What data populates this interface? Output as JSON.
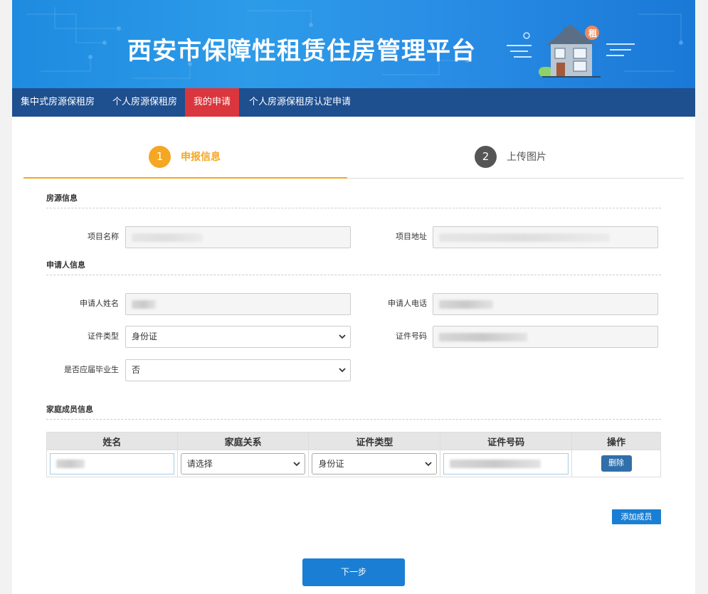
{
  "banner": {
    "title": "西安市保障性租赁住房管理平台",
    "badge": "租"
  },
  "nav": {
    "items": [
      {
        "label": "集中式房源保租房"
      },
      {
        "label": "个人房源保租房"
      },
      {
        "label": "我的申请",
        "active": true
      },
      {
        "label": "个人房源保租房认定申请"
      }
    ]
  },
  "steps": [
    {
      "num": "1",
      "label": "申报信息",
      "active": true
    },
    {
      "num": "2",
      "label": "上传图片",
      "active": false
    }
  ],
  "sections": {
    "housing": "房源信息",
    "applicant": "申请人信息",
    "family": "家庭成员信息"
  },
  "fields": {
    "project_name": {
      "label": "项目名称",
      "value": ""
    },
    "project_address": {
      "label": "项目地址",
      "value": ""
    },
    "applicant_name": {
      "label": "申请人姓名",
      "value": ""
    },
    "applicant_phone": {
      "label": "申请人电话",
      "value": ""
    },
    "id_type": {
      "label": "证件类型",
      "value": "身份证"
    },
    "id_number": {
      "label": "证件号码",
      "value": ""
    },
    "graduate": {
      "label": "是否应届毕业生",
      "value": "否"
    }
  },
  "family_table": {
    "headers": [
      "姓名",
      "家庭关系",
      "证件类型",
      "证件号码",
      "操作"
    ],
    "rows": [
      {
        "name": "",
        "relation": "请选择",
        "id_type": "身份证",
        "id_number": "",
        "action": "删除"
      }
    ]
  },
  "buttons": {
    "add_member": "添加成员",
    "next": "下一步"
  },
  "colors": {
    "banner_blue": "#2a8fe6",
    "nav_bg": "#1e4f8f",
    "nav_active": "#d9363e",
    "step_active": "#f5a623",
    "button_blue": "#1a7fd4"
  }
}
